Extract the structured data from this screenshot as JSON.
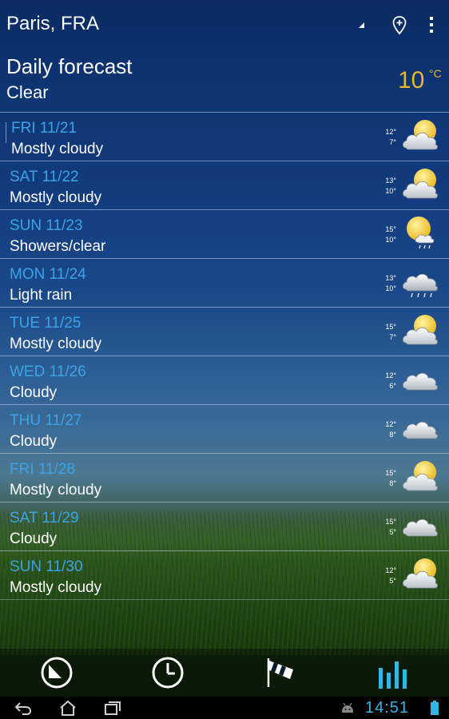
{
  "header": {
    "city": "Paris, FRA",
    "title": "Daily forecast",
    "condition": "Clear",
    "current_temp": "10",
    "current_unit": "°C"
  },
  "days": [
    {
      "date": "FRI 11/21",
      "desc": "Mostly cloudy",
      "hi": "12°",
      "lo": "7°",
      "icon": "mostly-cloudy-icon"
    },
    {
      "date": "SAT 11/22",
      "desc": "Mostly cloudy",
      "hi": "13°",
      "lo": "10°",
      "icon": "mostly-cloudy-icon"
    },
    {
      "date": "SUN 11/23",
      "desc": "Showers/clear",
      "hi": "15°",
      "lo": "10°",
      "icon": "showers-clear-icon"
    },
    {
      "date": "MON 11/24",
      "desc": "Light rain",
      "hi": "13°",
      "lo": "10°",
      "icon": "light-rain-icon"
    },
    {
      "date": "TUE 11/25",
      "desc": "Mostly cloudy",
      "hi": "15°",
      "lo": "7°",
      "icon": "mostly-cloudy-icon"
    },
    {
      "date": "WED 11/26",
      "desc": "Cloudy",
      "hi": "12°",
      "lo": "6°",
      "icon": "cloudy-icon"
    },
    {
      "date": "THU 11/27",
      "desc": "Cloudy",
      "hi": "12°",
      "lo": "8°",
      "icon": "cloudy-icon"
    },
    {
      "date": "FRI 11/28",
      "desc": "Mostly cloudy",
      "hi": "15°",
      "lo": "8°",
      "icon": "mostly-cloudy-icon"
    },
    {
      "date": "SAT 11/29",
      "desc": "Cloudy",
      "hi": "15°",
      "lo": "5°",
      "icon": "cloudy-icon"
    },
    {
      "date": "SUN 11/30",
      "desc": "Mostly cloudy",
      "hi": "12°",
      "lo": "5°",
      "icon": "mostly-cloudy-icon"
    }
  ],
  "tabs": [
    {
      "icon": "current-conditions-icon",
      "active": false
    },
    {
      "icon": "clock-icon",
      "active": false
    },
    {
      "icon": "windsock-icon",
      "active": false
    },
    {
      "icon": "bar-chart-icon",
      "active": true
    }
  ],
  "status_bar": {
    "time": "14:51"
  },
  "colors": {
    "accent": "#33b5e5",
    "date_text": "#3aa4e6",
    "current_temp": "#e6b82c"
  }
}
